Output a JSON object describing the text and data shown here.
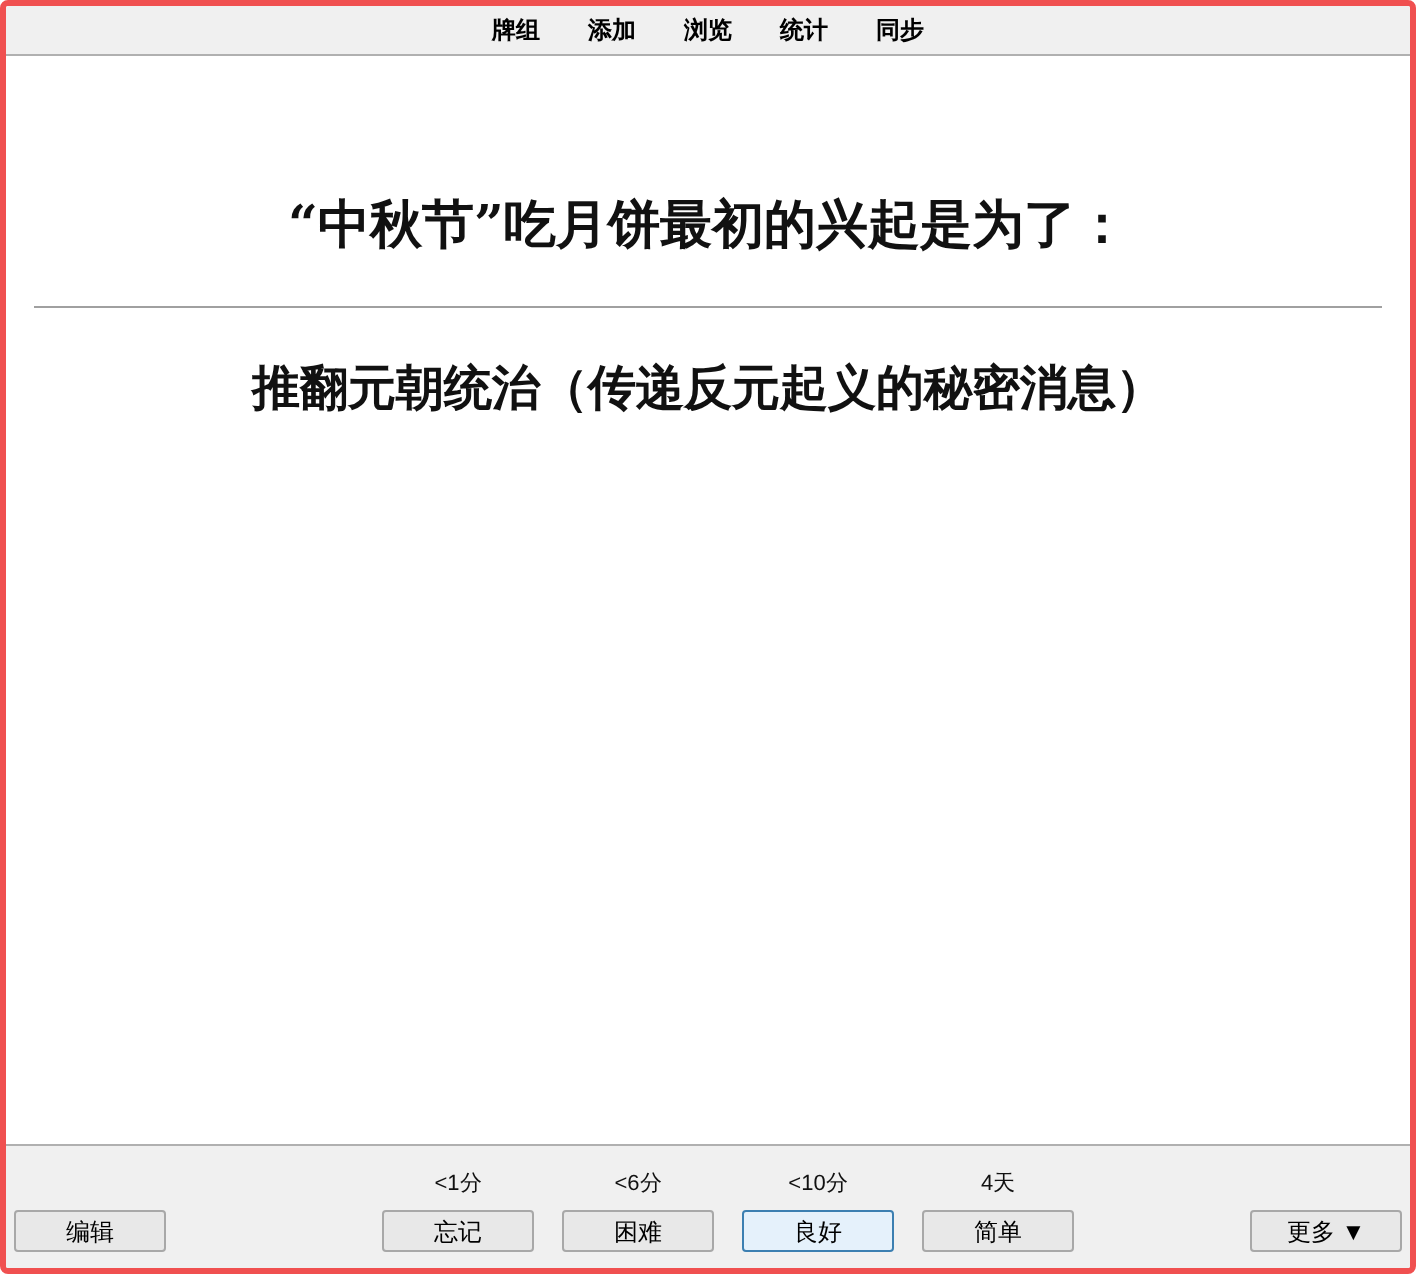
{
  "menu": [
    "牌组",
    "添加",
    "浏览",
    "统计",
    "同步"
  ],
  "question": "“中秋节”吃月饼最初的兴起是为了：",
  "answer": "推翻元朝统治（传递反元起义的秘密消息）",
  "edit_button": "编辑",
  "answer_buttons": [
    {
      "interval": "<1分",
      "label": "忘记",
      "selected": false
    },
    {
      "interval": "<6分",
      "label": "困难",
      "selected": false
    },
    {
      "interval": "<10分",
      "label": "良好",
      "selected": true
    },
    {
      "interval": "4天",
      "label": "简单",
      "selected": false
    }
  ],
  "more_button": "更多 ▼"
}
